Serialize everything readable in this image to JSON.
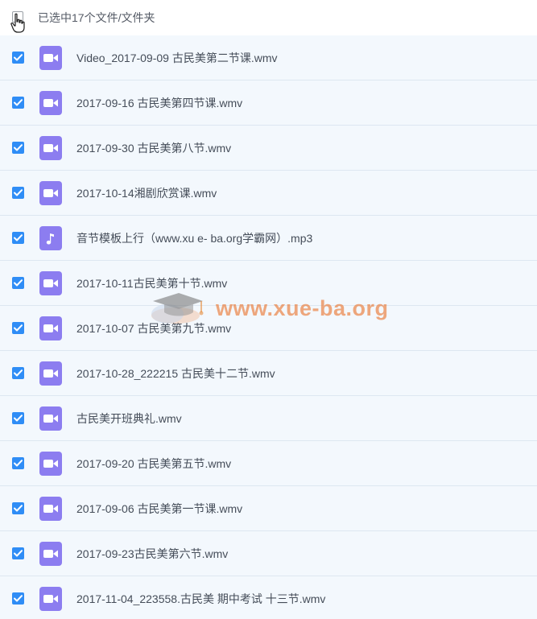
{
  "header": {
    "selection_text": "已选中17个文件/文件夹"
  },
  "files": [
    {
      "name": "Video_2017-09-09 古民美第二节课.wmv",
      "type": "video",
      "checked": true
    },
    {
      "name": "2017-09-16 古民美第四节课.wmv",
      "type": "video",
      "checked": true
    },
    {
      "name": "2017-09-30 古民美第八节.wmv",
      "type": "video",
      "checked": true
    },
    {
      "name": "2017-10-14湘剧欣赏课.wmv",
      "type": "video",
      "checked": true
    },
    {
      "name": "音节模板上行（www.xu e- ba.org学霸网）.mp3",
      "type": "audio",
      "checked": true
    },
    {
      "name": "2017-10-11古民美第十节.wmv",
      "type": "video",
      "checked": true
    },
    {
      "name": "2017-10-07 古民美第九节.wmv",
      "type": "video",
      "checked": true
    },
    {
      "name": "2017-10-28_222215 古民美十二节.wmv",
      "type": "video",
      "checked": true
    },
    {
      "name": "古民美开班典礼.wmv",
      "type": "video",
      "checked": true
    },
    {
      "name": "2017-09-20 古民美第五节.wmv",
      "type": "video",
      "checked": true
    },
    {
      "name": "2017-09-06 古民美第一节课.wmv",
      "type": "video",
      "checked": true
    },
    {
      "name": "2017-09-23古民美第六节.wmv",
      "type": "video",
      "checked": true
    },
    {
      "name": "2017-11-04_223558.古民美 期中考试 十三节.wmv",
      "type": "video",
      "checked": true
    }
  ],
  "watermark": {
    "text": "www.xue-ba.org"
  },
  "colors": {
    "checkbox": "#2f8df6",
    "file_icon": "#8c7df0",
    "row_background": "#f3f8fd",
    "row_divider": "#dde7f1",
    "watermark": "#e97a38"
  },
  "icons": {
    "video": "video-camera-icon",
    "audio": "music-note-icon",
    "check": "checkmark-icon"
  }
}
